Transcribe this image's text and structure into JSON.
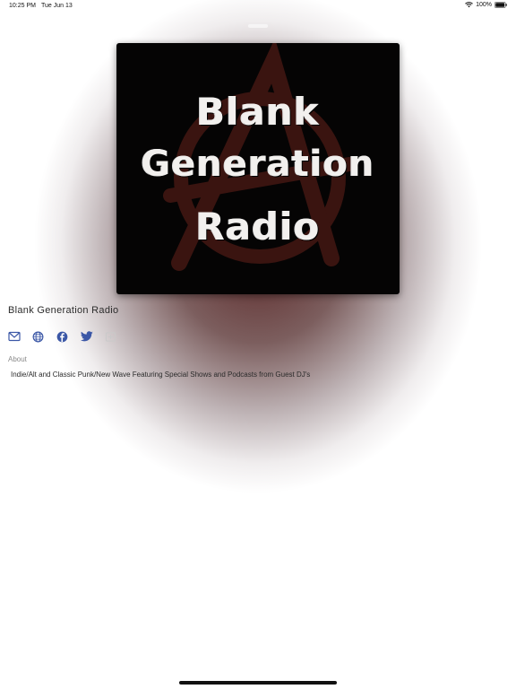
{
  "status_bar": {
    "time": "10:25 PM",
    "date": "Tue Jun 13",
    "battery": "100%",
    "icons": [
      "wifi-icon",
      "battery-icon"
    ]
  },
  "artwork": {
    "line1": "Blank",
    "line2": "Generation",
    "line3": "Radio",
    "background_color": "#050404",
    "emblem_color": "#3a1410",
    "emblem_icon": "anarchy-symbol-icon"
  },
  "station": {
    "title": "Blank Generation Radio"
  },
  "actions": [
    {
      "icon": "mail-icon"
    },
    {
      "icon": "globe-icon"
    },
    {
      "icon": "facebook-icon"
    },
    {
      "icon": "twitter-icon"
    },
    {
      "icon": "share-icon"
    }
  ],
  "about": {
    "label": "About",
    "text": "Indie/Alt and Classic Punk/New Wave Featuring Special Shows and Podcasts from Guest DJ's"
  },
  "colors": {
    "accent": "#3b57a6",
    "glow": "#4b1212"
  }
}
